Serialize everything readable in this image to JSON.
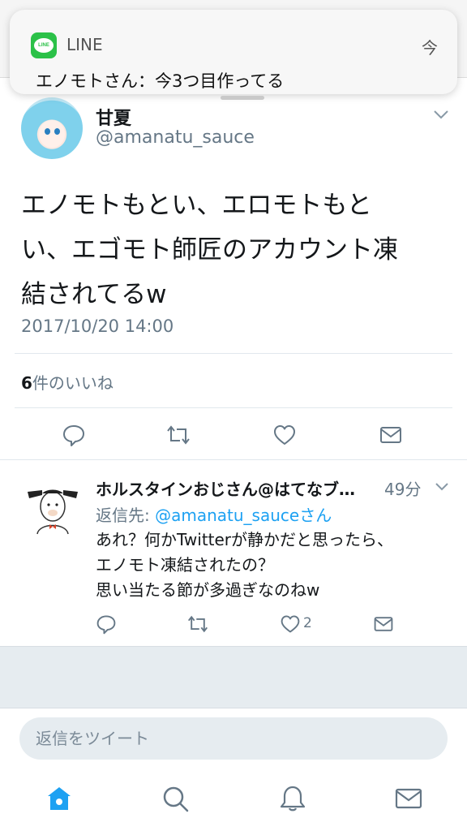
{
  "notification": {
    "app_name": "LINE",
    "app_icon_text": "LINE",
    "time": "今",
    "message": "エノモトさん：今3つ目作ってる"
  },
  "tweet": {
    "display_name": "甘夏",
    "screen_name": "@amanatu_sauce",
    "text_lines": [
      "エノモトもとい、エロモトもと",
      "い、エゴモト師匠のアカウント凍",
      "結されてるw"
    ],
    "date": "2017/10/20 14:00",
    "likes_count": "6",
    "likes_label": "件のいいね"
  },
  "reply": {
    "display_name": "ホルスタインおじさん@はてなブ…",
    "time": "49分",
    "reply_to_prefix": "返信先: ",
    "reply_to_mention": "@amanatu_sauce",
    "reply_to_suffix": "さん",
    "text_lines": [
      "あれ？何かTwitterが静かだと思ったら、",
      "エノモト凍結されたの？",
      "思い当たる節が多過ぎなのねw"
    ],
    "like_count": "2"
  },
  "compose": {
    "placeholder": "返信をツイート"
  },
  "icons": {
    "reply": "reply-icon",
    "retweet": "retweet-icon",
    "like": "heart-icon",
    "dm": "envelope-icon",
    "home": "home-icon",
    "search": "search-icon",
    "notifications": "bell-icon",
    "messages": "envelope-icon"
  },
  "colors": {
    "accent": "#1da1f2",
    "line_green": "#2bc148",
    "secondary_text": "#657786",
    "icon_gray": "#657786"
  }
}
